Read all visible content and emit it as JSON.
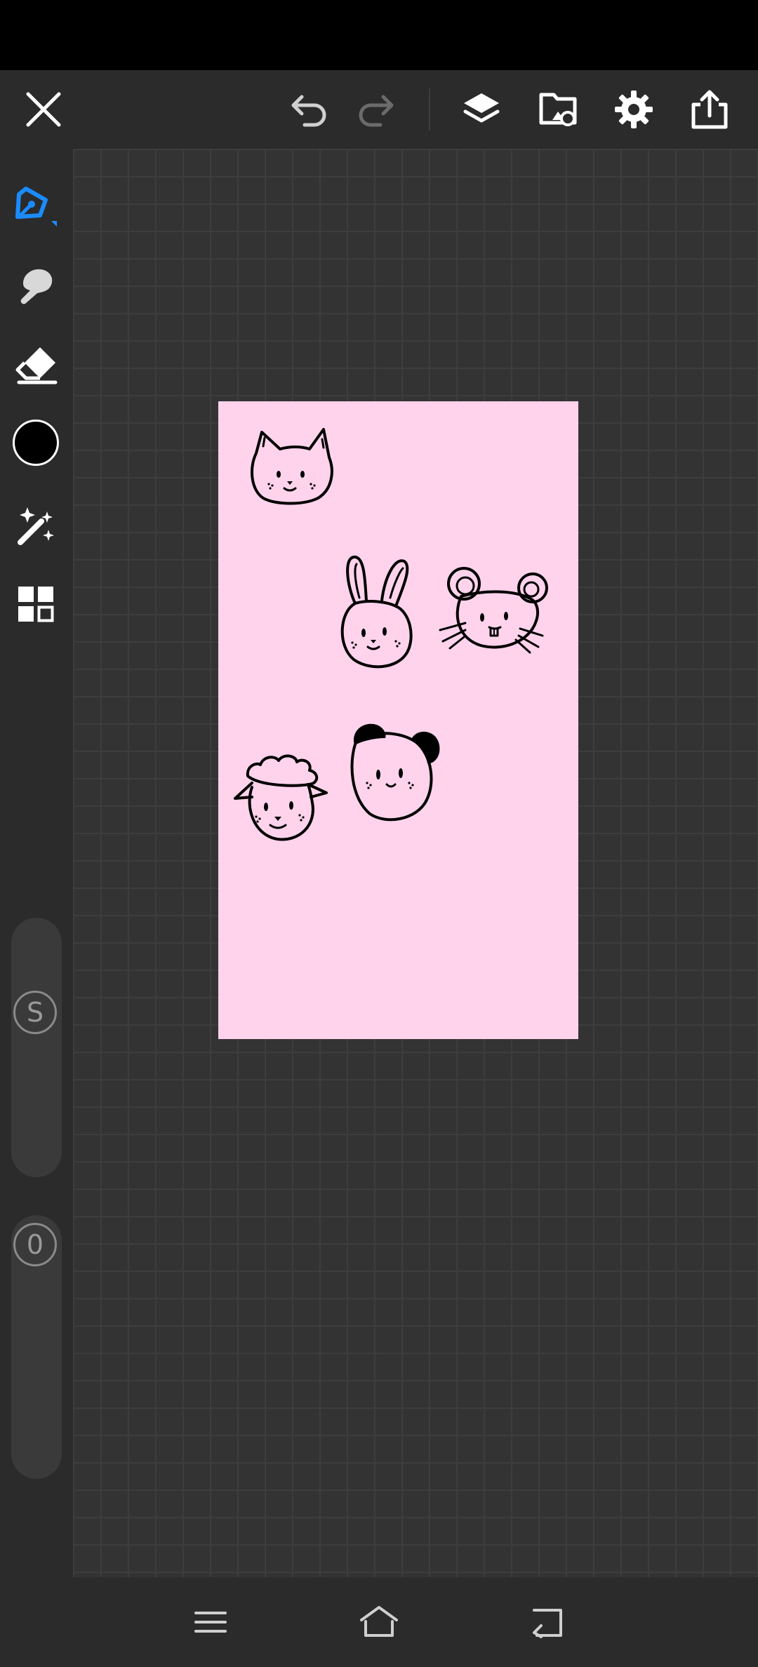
{
  "app": {
    "accent_color": "#1a8cff",
    "canvas_color": "#ffd3ec",
    "brush_color": "#000000"
  },
  "top_toolbar": {
    "icons": [
      "close-icon",
      "undo-icon",
      "redo-icon",
      "layers-icon",
      "import-image-icon",
      "settings-icon",
      "share-icon"
    ]
  },
  "left_toolbar": {
    "tools": [
      "pen-tool-icon",
      "smudge-tool-icon",
      "eraser-tool-icon",
      "color-picker",
      "magic-wand-icon",
      "gallery-icon"
    ],
    "size_slider": {
      "label": "S"
    },
    "opacity_slider": {
      "label": "0"
    }
  },
  "canvas": {
    "doodles": [
      "cat-face",
      "bunny-face",
      "mouse-face",
      "sheep-face",
      "panda-face"
    ]
  },
  "nav_bar": {
    "icons": [
      "recents-icon",
      "home-icon",
      "back-icon"
    ]
  }
}
